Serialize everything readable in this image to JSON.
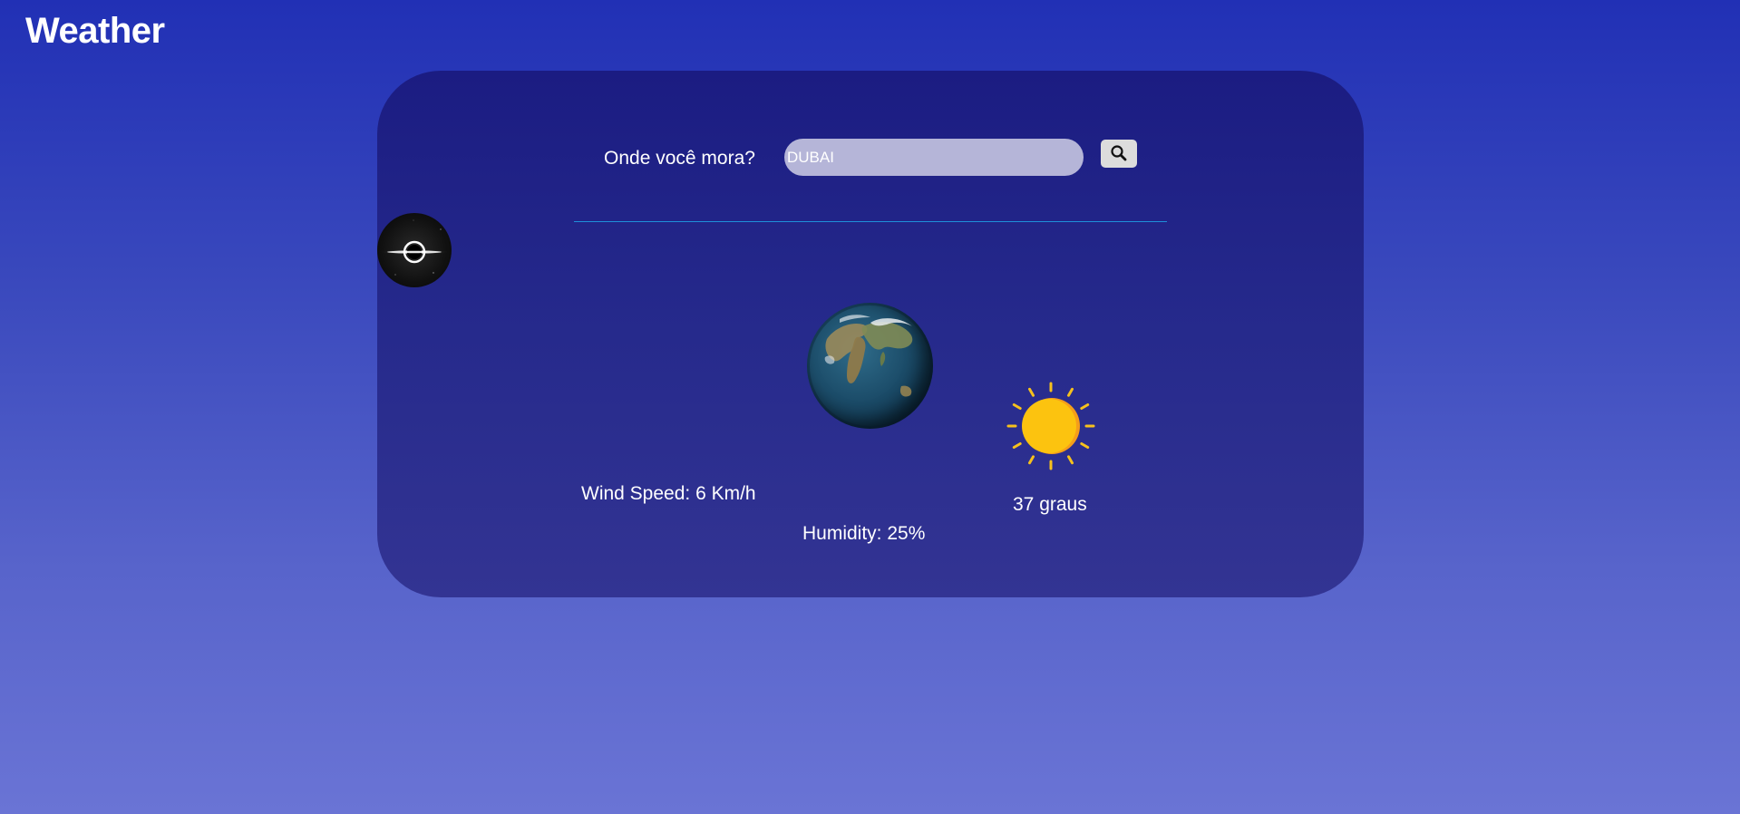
{
  "app": {
    "title": "Weather"
  },
  "search": {
    "label": "Onde você mora?",
    "value": "DUBAI",
    "button_icon": "search-icon"
  },
  "weather": {
    "wind_speed": "Wind Speed: 6 Km/h",
    "humidity": "Humidity: 25%",
    "temperature": "37 graus",
    "condition_icon": "sun-icon"
  },
  "decor": {
    "left_icon": "black-hole-icon",
    "center_image": "earth-globe-icon"
  },
  "colors": {
    "background_top": "#2130b5",
    "background_bottom": "#6a74d5",
    "card_top": "#1b1c82",
    "card_bottom": "#333493",
    "input_bg": "#b5b5d8",
    "button_bg": "#dcdcdc",
    "divider": "#1f8fd9",
    "sun": "#fbbf0f"
  }
}
